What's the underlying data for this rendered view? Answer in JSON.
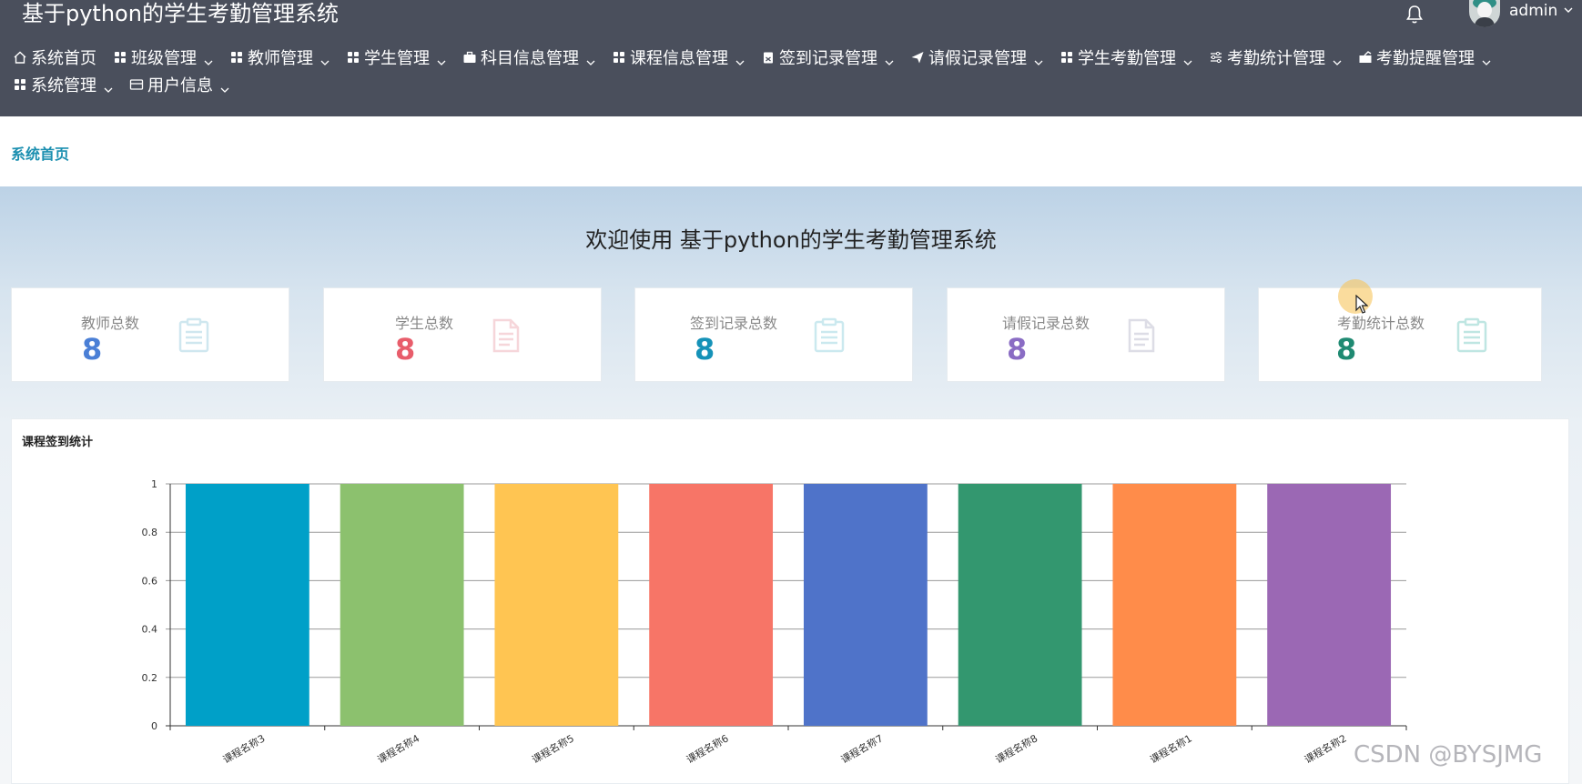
{
  "header": {
    "app_title": "基于python的学生考勤管理系统",
    "user_name": "admin"
  },
  "nav": {
    "items": [
      {
        "label": "系统首页",
        "icon": "home-icon",
        "has_caret": false
      },
      {
        "label": "班级管理",
        "icon": "grid-icon",
        "has_caret": true
      },
      {
        "label": "教师管理",
        "icon": "grid-icon",
        "has_caret": true
      },
      {
        "label": "学生管理",
        "icon": "grid-icon",
        "has_caret": true
      },
      {
        "label": "科目信息管理",
        "icon": "briefcase-icon",
        "has_caret": true
      },
      {
        "label": "课程信息管理",
        "icon": "grid-icon",
        "has_caret": true
      },
      {
        "label": "签到记录管理",
        "icon": "clipboard-icon",
        "has_caret": true
      },
      {
        "label": "请假记录管理",
        "icon": "send-icon",
        "has_caret": true
      },
      {
        "label": "学生考勤管理",
        "icon": "grid-icon",
        "has_caret": true
      },
      {
        "label": "考勤统计管理",
        "icon": "sliders-icon",
        "has_caret": true
      },
      {
        "label": "考勤提醒管理",
        "icon": "share-icon",
        "has_caret": true
      },
      {
        "label": "系统管理",
        "icon": "grid-icon",
        "has_caret": true
      },
      {
        "label": "用户信息",
        "icon": "card-icon",
        "has_caret": true
      }
    ]
  },
  "breadcrumb": {
    "current": "系统首页"
  },
  "welcome": "欢迎使用 基于python的学生考勤管理系统",
  "stats": [
    {
      "label": "教师总数",
      "value": "8",
      "color": "#4a7fd6",
      "icon_color": "#cfe7ef"
    },
    {
      "label": "学生总数",
      "value": "8",
      "color": "#e85d6b",
      "icon_color": "#f6d6da"
    },
    {
      "label": "签到记录总数",
      "value": "8",
      "color": "#1592b8",
      "icon_color": "#cbe9ef"
    },
    {
      "label": "请假记录总数",
      "value": "8",
      "color": "#8a6cc4",
      "icon_color": "#dddde6"
    },
    {
      "label": "考勤统计总数",
      "value": "8",
      "color": "#1f8a72",
      "icon_color": "#bfe6e2"
    }
  ],
  "chart_title": "课程签到统计",
  "chart_data": {
    "type": "bar",
    "categories": [
      "课程名称3",
      "课程名称4",
      "课程名称5",
      "课程名称6",
      "课程名称7",
      "课程名称8",
      "课程名称1",
      "课程名称2"
    ],
    "values": [
      1,
      1,
      1,
      1,
      1,
      1,
      1,
      1
    ],
    "colors": [
      "#00a0c8",
      "#8cc16e",
      "#ffc552",
      "#f77567",
      "#4f73c9",
      "#33976f",
      "#ff8c4a",
      "#9b68b4"
    ],
    "ylim": [
      0,
      1
    ],
    "yticks": [
      "0",
      "0.2",
      "0.4",
      "0.6",
      "0.8",
      "1"
    ],
    "grid": true
  },
  "watermark": "CSDN @BYSJMG"
}
